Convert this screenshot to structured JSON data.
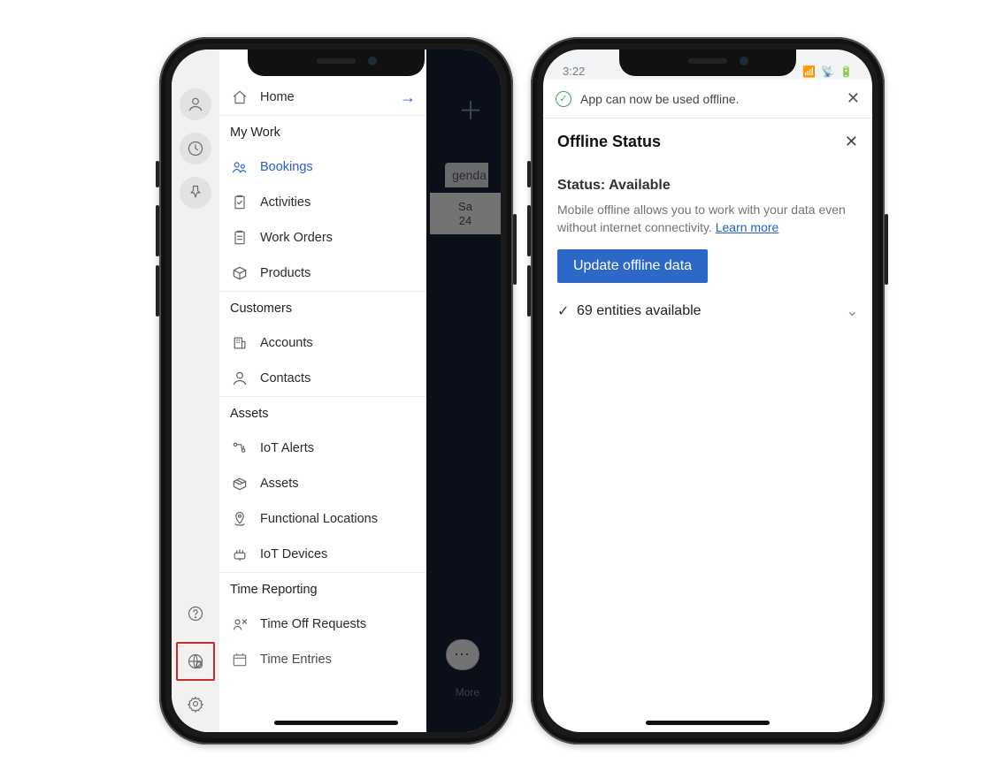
{
  "phone1": {
    "statusbar": {
      "time": ""
    },
    "background": {
      "tab_label": "genda",
      "day_name": "Sa",
      "day_num": "24",
      "more_label": "More"
    },
    "rail": {},
    "menu": {
      "home": "Home",
      "groups": [
        {
          "title": "My Work",
          "items": [
            {
              "key": "bookings",
              "label": "Bookings",
              "active": true
            },
            {
              "key": "activities",
              "label": "Activities"
            },
            {
              "key": "work_orders",
              "label": "Work Orders"
            },
            {
              "key": "products",
              "label": "Products"
            }
          ]
        },
        {
          "title": "Customers",
          "items": [
            {
              "key": "accounts",
              "label": "Accounts"
            },
            {
              "key": "contacts",
              "label": "Contacts"
            }
          ]
        },
        {
          "title": "Assets",
          "items": [
            {
              "key": "iot_alerts",
              "label": "IoT Alerts"
            },
            {
              "key": "assets",
              "label": "Assets"
            },
            {
              "key": "functional_locations",
              "label": "Functional Locations"
            },
            {
              "key": "iot_devices",
              "label": "IoT Devices"
            }
          ]
        },
        {
          "title": "Time Reporting",
          "items": [
            {
              "key": "time_off_requests",
              "label": "Time Off Requests"
            },
            {
              "key": "time_entries",
              "label": "Time Entries"
            }
          ]
        }
      ]
    }
  },
  "phone2": {
    "statusbar": {
      "time": "3:22"
    },
    "toast": {
      "message": "App can now be used offline."
    },
    "pane": {
      "title": "Offline Status",
      "status_label": "Status:",
      "status_value": "Available",
      "description": "Mobile offline allows you to work with your data even without internet connectivity.",
      "learn_more": "Learn more",
      "button": "Update offline data",
      "entities_count": 69,
      "entities_label": "69 entities available"
    }
  }
}
